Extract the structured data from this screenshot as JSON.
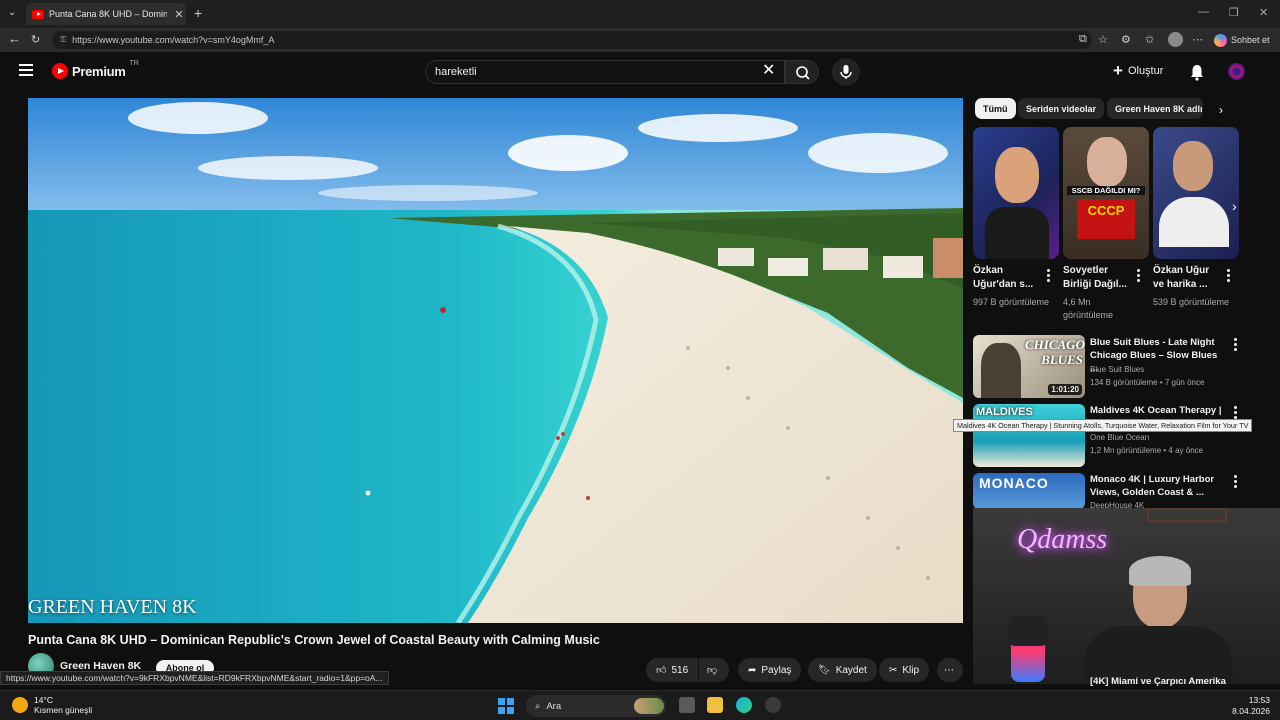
{
  "browser": {
    "tab_title": "Punta Cana 8K UHD – Dominican",
    "url": "https://www.youtube.com/watch?v=smY4ogMmf_A",
    "copilot_label": "Sohbet et"
  },
  "header": {
    "logo_text": "Premium",
    "logo_region": "TR",
    "search_value": "hareketli",
    "create_label": "Oluştur"
  },
  "video": {
    "watermark": "GREEN HAVEN 8K",
    "title": "Punta Cana 8K UHD – Dominican Republic's Crown Jewel of Coastal Beauty with Calming Music",
    "channel": "Green Haven 8K",
    "subscribe_label": "Abone ol",
    "likes": "516",
    "share_label": "Paylaş",
    "save_label": "Kaydet",
    "clip_label": "Klip"
  },
  "status_url": "https://www.youtube.com/watch?v=9kFRXbpvNME&list=RD9kFRXbpvNME&start_radio=1&pp=oA...",
  "sidebar": {
    "chips": [
      "Tümü",
      "Seriden videolar",
      "Green Haven 8K adlı"
    ],
    "shorts": [
      {
        "title": "Özkan Uğur'dan s...",
        "views": "997 B görüntüleme"
      },
      {
        "title": "Sovyetler Birliği Dağıl...",
        "views": "4,6 Mn görüntüleme",
        "overlay": "SSCB DAĞILDI MI?",
        "overlay2": "CCCP"
      },
      {
        "title": "Özkan Uğur ve harika ...",
        "views": "539 B görüntüleme"
      }
    ],
    "recommendations": [
      {
        "title": "Blue Suit Blues - Late Night Chicago Blues – Slow Blues ...",
        "channel": "Blue Suit Blues",
        "meta": "134 B görüntüleme • 7 gün önce",
        "duration": "1:01:20",
        "thumb_text": "CHICAGO BLUES"
      },
      {
        "title": "Maldives 4K Ocean Therapy |",
        "channel": "One Blue Ocean",
        "meta": "1,2 Mn görüntüleme • 4 ay önce",
        "thumb_text": "MALDIVES"
      },
      {
        "title": "Monaco 4K | Luxury Harbor Views, Golden Coast & ...",
        "channel": "DeepHouse 4K",
        "thumb_text": "MONACO"
      }
    ],
    "tooltip": "Maldives 4K Ocean Therapy | Stunning Atolls, Turquoise Water, Relaxation Film for Your TV",
    "bottom_item": "[4K] Miami ve Çarpıcı Amerika"
  },
  "webcam": {
    "neon_text": "Qdamss"
  },
  "taskbar": {
    "temperature": "14°C",
    "weather": "Kısmen güneşli",
    "search_label": "Ara",
    "time": "13:53",
    "date": "8.04.2026"
  },
  "colors": {
    "background": "#0f0f0f",
    "youtube_red": "#ff0000",
    "chip_active": "#f1f1f1"
  }
}
